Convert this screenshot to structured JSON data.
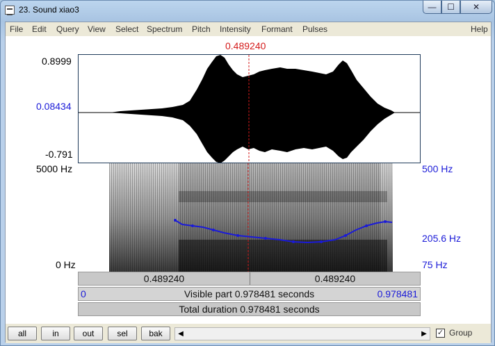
{
  "window": {
    "title": "23. Sound xiao3",
    "minimize": "—",
    "maximize": "☐",
    "close": "✕"
  },
  "menu": [
    "File",
    "Edit",
    "Query",
    "View",
    "Select",
    "Spectrum",
    "Pitch",
    "Intensity",
    "Formant",
    "Pulses",
    "Help"
  ],
  "cursor": {
    "time": "0.489240"
  },
  "waveform": {
    "top": "0.8999",
    "cursor_value": "0.08434",
    "bottom": "-0.791"
  },
  "spectrogram": {
    "freq_top": "5000 Hz",
    "freq_bottom": "0 Hz"
  },
  "pitch": {
    "top": "500 Hz",
    "value": "205.6 Hz",
    "bottom": "75 Hz"
  },
  "bars": {
    "left_time": "0.489240",
    "right_time": "0.489240",
    "visible_start": "0",
    "visible_text": "Visible part 0.978481 seconds",
    "visible_end": "0.978481",
    "total_text": "Total duration 0.978481 seconds"
  },
  "buttons": {
    "all": "all",
    "in": "in",
    "out": "out",
    "sel": "sel",
    "bak": "bak"
  },
  "scroll": {
    "left_arrow": "◀",
    "right_arrow": "▶"
  },
  "group": {
    "label": "Group",
    "checked": "✓"
  },
  "colors": {
    "cursor": "#d41a1a",
    "pitch": "#1a1ad8"
  }
}
